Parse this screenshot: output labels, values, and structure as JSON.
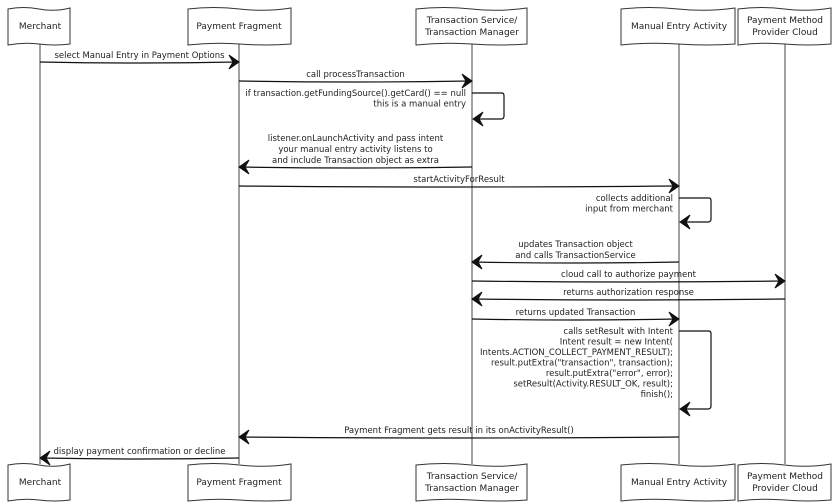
{
  "participants": [
    {
      "id": "merchant",
      "label": [
        "Merchant"
      ]
    },
    {
      "id": "fragment",
      "label": [
        "Payment Fragment"
      ]
    },
    {
      "id": "service",
      "label": [
        "Transaction Service/",
        "Transaction Manager"
      ]
    },
    {
      "id": "activity",
      "label": [
        "Manual Entry Activity"
      ]
    },
    {
      "id": "cloud",
      "label": [
        "Payment Method",
        "Provider Cloud"
      ]
    }
  ],
  "messages": [
    {
      "from": "merchant",
      "to": "fragment",
      "lines": [
        "select Manual Entry in Payment Options"
      ]
    },
    {
      "from": "fragment",
      "to": "service",
      "lines": [
        "call processTransaction"
      ]
    },
    {
      "from": "service",
      "to": "service",
      "lines": [
        "if transaction.getFundingSource().getCard() == null",
        "this is a manual entry"
      ]
    },
    {
      "from": "service",
      "to": "fragment",
      "lines": [
        "listener.onLaunchActivity and pass intent",
        "your manual entry activity listens to",
        "and include Transaction object as extra"
      ]
    },
    {
      "from": "fragment",
      "to": "activity",
      "lines": [
        "startActivityForResult"
      ]
    },
    {
      "from": "activity",
      "to": "activity",
      "lines": [
        "collects additional",
        "input from merchant"
      ]
    },
    {
      "from": "activity",
      "to": "service",
      "lines": [
        "updates Transaction object",
        "and calls TransactionService"
      ]
    },
    {
      "from": "service",
      "to": "cloud",
      "lines": [
        "cloud call to authorize payment"
      ]
    },
    {
      "from": "cloud",
      "to": "service",
      "lines": [
        "returns authorization response"
      ]
    },
    {
      "from": "service",
      "to": "activity",
      "lines": [
        "returns updated Transaction"
      ]
    },
    {
      "from": "activity",
      "to": "activity",
      "lines": [
        "calls setResult with Intent",
        "Intent result = new Intent(",
        "Intents.ACTION_COLLECT_PAYMENT_RESULT);",
        "result.putExtra(\"transaction\", transaction);",
        "result.putExtra(\"error\", error);",
        "setResult(Activity.RESULT_OK, result);",
        "finish();"
      ]
    },
    {
      "from": "activity",
      "to": "fragment",
      "lines": [
        "Payment Fragment gets result in its onActivityResult()"
      ]
    },
    {
      "from": "fragment",
      "to": "merchant",
      "lines": [
        "display payment confirmation or decline"
      ]
    }
  ]
}
